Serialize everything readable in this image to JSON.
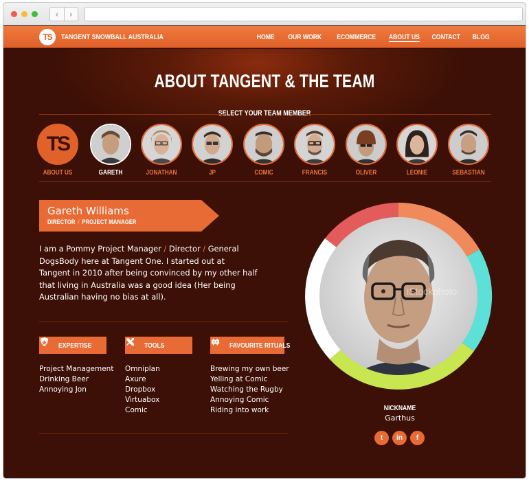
{
  "browser": {
    "back_icon": "chevron-left-icon",
    "forward_icon": "chevron-right-icon",
    "url": ""
  },
  "header": {
    "logo_text": "TS",
    "brand": "TANGENT SNOWBALL AUSTRALIA",
    "nav": [
      "HOME",
      "OUR WORK",
      "ECOMMERCE",
      "ABOUT US",
      "CONTACT",
      "BLOG"
    ],
    "active_nav": "ABOUT US"
  },
  "page": {
    "title": "ABOUT TANGENT & THE TEAM",
    "select_label": "SELECT YOUR TEAM MEMBER"
  },
  "team": [
    {
      "label": "ABOUT US",
      "logo": "TS"
    },
    {
      "label": "GARETH",
      "active": true
    },
    {
      "label": "JONATHAN"
    },
    {
      "label": "JP"
    },
    {
      "label": "COMIC"
    },
    {
      "label": "FRANCIS"
    },
    {
      "label": "OLIVER"
    },
    {
      "label": "LEONIE"
    },
    {
      "label": "SEBASTIAN"
    }
  ],
  "profile": {
    "name": "Gareth Williams",
    "role_1": "DIRECTOR",
    "role_sep": "/",
    "role_2": "PROJECT MANAGER",
    "bio_1": "I am a Pommy Project Manager ",
    "bio_sep_1": "/",
    "bio_2": " Director ",
    "bio_sep_2": "/",
    "bio_3": " General DogsBody here at Tangent One. I started out at Tangent in 2010 after being convinced by my other half that living in Australia was a good idea (Her being Australian having no bias at all).",
    "nickname_label": "NICKNAME",
    "nickname": "Garthus",
    "watermark": "iStockphoto",
    "ring_colors": [
      "#e35b5b",
      "#f08a5a",
      "#5ce0d8",
      "#c8e650",
      "#ffffff"
    ]
  },
  "categories": {
    "expertise": {
      "title": "EXPERTISE",
      "icon": "shield-icon",
      "items": [
        "Project Management",
        "Drinking Beer",
        "Annoying Jon"
      ]
    },
    "tools": {
      "title": "TOOLS",
      "icon": "tools-icon",
      "items": [
        "Omniplan",
        "Axure",
        "Dropbox",
        "Virtuabox",
        "Comic"
      ]
    },
    "rituals": {
      "title": "FAVOURITE RITUALS",
      "icon": "space-invader-icon",
      "items": [
        "Brewing my own beer",
        "Yelling at Comic",
        "Watching the Rugby",
        "Annoying Comic",
        "Riding into work"
      ]
    }
  },
  "social": [
    {
      "name": "twitter-icon",
      "glyph": "t"
    },
    {
      "name": "linkedin-icon",
      "glyph": "in"
    },
    {
      "name": "facebook-icon",
      "glyph": "f"
    }
  ],
  "colors": {
    "accent": "#e86a34",
    "background": "#3c1006"
  }
}
